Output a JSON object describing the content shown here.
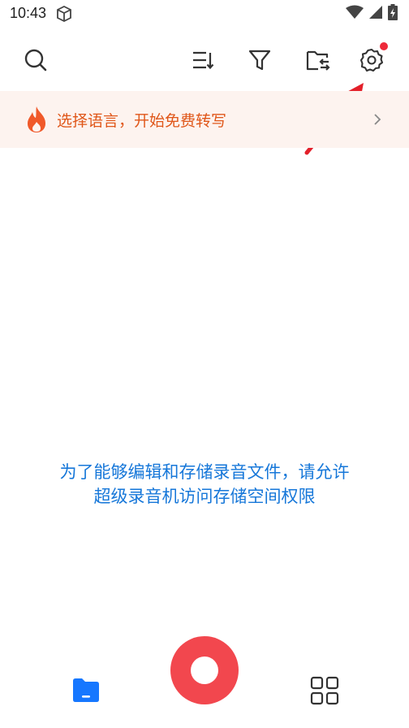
{
  "status_bar": {
    "time": "10:43",
    "icons": [
      "box-icon",
      "wifi-icon",
      "signal-icon",
      "battery-charging-icon"
    ]
  },
  "toolbar": {
    "icons": [
      "search-icon",
      "sort-icon",
      "filter-icon",
      "folder-move-icon",
      "settings-icon"
    ],
    "settings_has_badge": true,
    "badge_color": "#ee2a3a"
  },
  "banner": {
    "text": "选择语言，开始免费转写",
    "icon": "flame-icon",
    "text_color": "#e0571a",
    "background": "#fdf3ef"
  },
  "annotation": {
    "icon": "red-arrow-icon",
    "color": "#e3202a"
  },
  "main": {
    "permission_line1": "为了能够编辑和存储录音文件，请允许",
    "permission_line2": "超级录音机访问存储空间权限",
    "link_color": "#1677d9"
  },
  "bottom_nav": {
    "items": [
      "files-icon",
      "record-button",
      "apps-grid-icon"
    ],
    "record_color": "#f2474e",
    "accent": "#1677ff"
  }
}
